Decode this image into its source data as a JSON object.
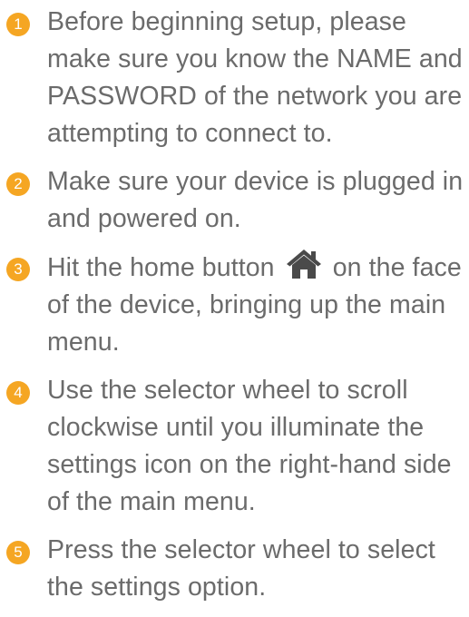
{
  "steps": [
    {
      "number": "1",
      "text": "Before beginning setup, please make sure you know the NAME and PASSWORD of the network you are attempting to connect to."
    },
    {
      "number": "2",
      "text": "Make sure your device is plugged in and powered on."
    },
    {
      "number": "3",
      "text_before": "Hit the home button",
      "icon": "home-icon",
      "text_after": "on the face of the device, bringing up the main menu."
    },
    {
      "number": "4",
      "text": "Use the selector wheel to scroll clockwise until you illuminate the settings icon on the right-hand side of the main menu."
    },
    {
      "number": "5",
      "text": "Press the selector wheel to select the settings option."
    }
  ],
  "colors": {
    "badge": "#f5a623",
    "text": "#6b6b6b",
    "icon": "#4a4a4a"
  }
}
